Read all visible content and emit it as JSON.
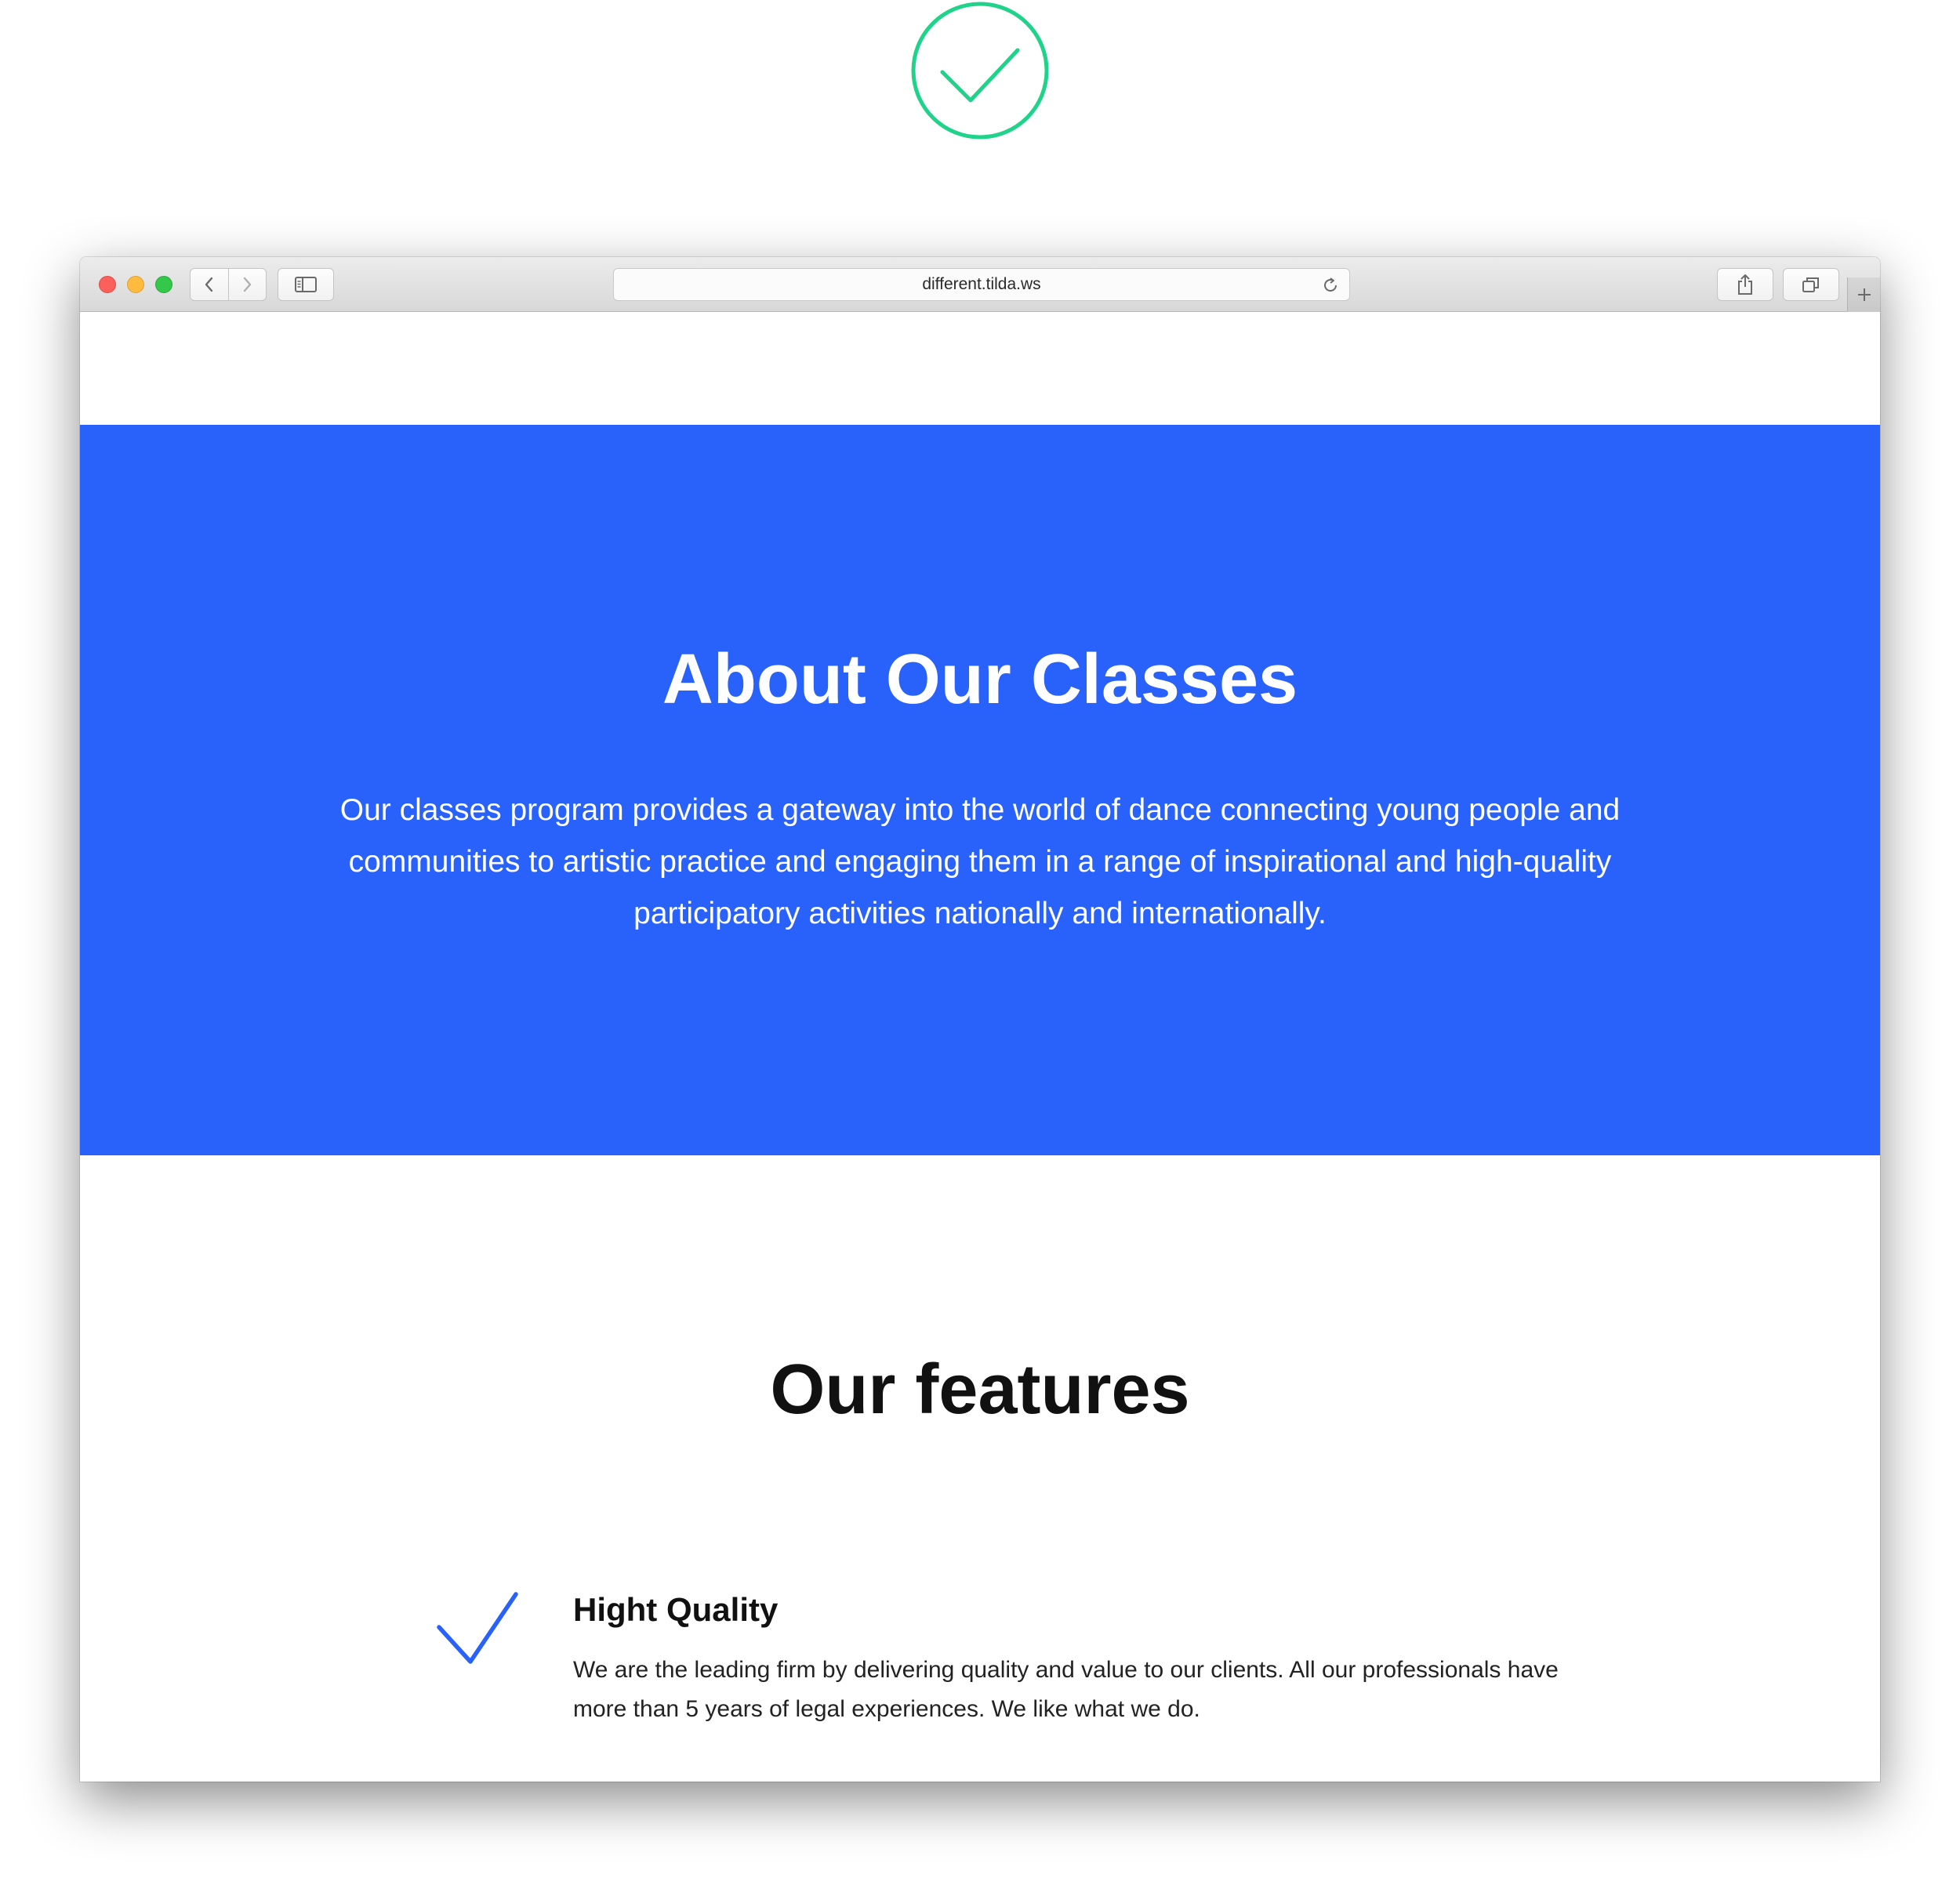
{
  "badge": {
    "icon": "checkmark-circle-icon",
    "color": "#1fd38a"
  },
  "browser": {
    "address": "different.tilda.ws",
    "icons": {
      "back": "chevron-left-icon",
      "forward": "chevron-right-icon",
      "sidebar": "sidebar-icon",
      "reload": "reload-icon",
      "share": "share-icon",
      "tabs": "tabs-overview-icon",
      "new_tab": "plus-icon"
    }
  },
  "hero": {
    "background": "#2961fb",
    "title": "About Our Classes",
    "lines": [
      "Our classes program provides a gateway into the world of dance connecting young people and",
      "communities to artistic practice and engaging them in a range of inspirational and high-quality",
      "participatory activities nationally and internationally."
    ]
  },
  "features": {
    "title": "Our features",
    "items": [
      {
        "icon": "checkmark-icon",
        "title": "Hight Quality",
        "lines": [
          "We are the leading firm by delivering quality and value to our clients. All our professionals have",
          "more than 5 years of legal experiences. We like what we do."
        ]
      }
    ]
  },
  "colors": {
    "accent": "#2961fb",
    "badge": "#1fd38a"
  }
}
